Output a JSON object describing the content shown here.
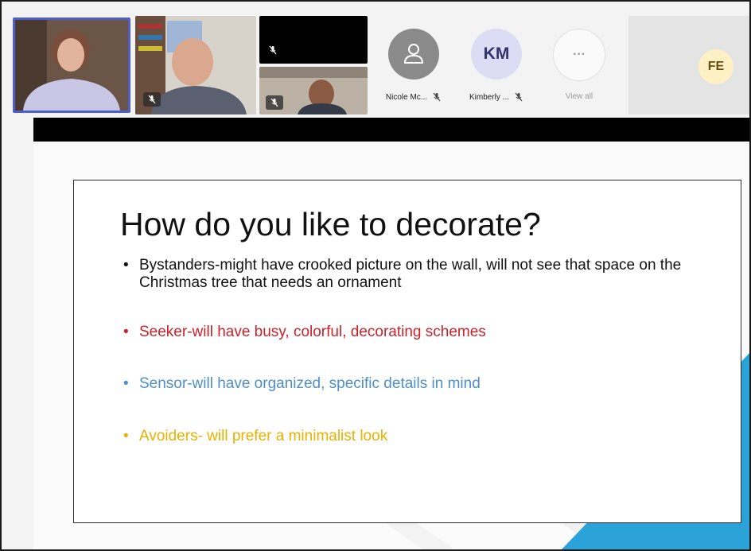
{
  "participants": {
    "nicole": {
      "initials": "",
      "name": "Nicole Mc..."
    },
    "kimberly": {
      "initials": "KM",
      "name": "Kimberly ..."
    },
    "view_all": {
      "label": "View all"
    },
    "fe": {
      "initials": "FE"
    }
  },
  "slide": {
    "title": "How do you like to decorate?",
    "bullets": [
      {
        "marker": "•",
        "text": "Bystanders-might have crooked picture on the wall, will not see that space on the Christmas tree that needs an ornament",
        "color": "#111111"
      },
      {
        "marker": "•",
        "text": "Seeker-will have busy, colorful, decorating schemes",
        "color": "#cc2128"
      },
      {
        "marker": "•",
        "text": "Sensor-will have organized, specific details in mind",
        "color": "#4f8fc7"
      },
      {
        "marker": "•",
        "text": "Avoiders- will prefer a minimalist look",
        "color": "#e8b200"
      }
    ],
    "accent_color": "#2ba3d8"
  }
}
